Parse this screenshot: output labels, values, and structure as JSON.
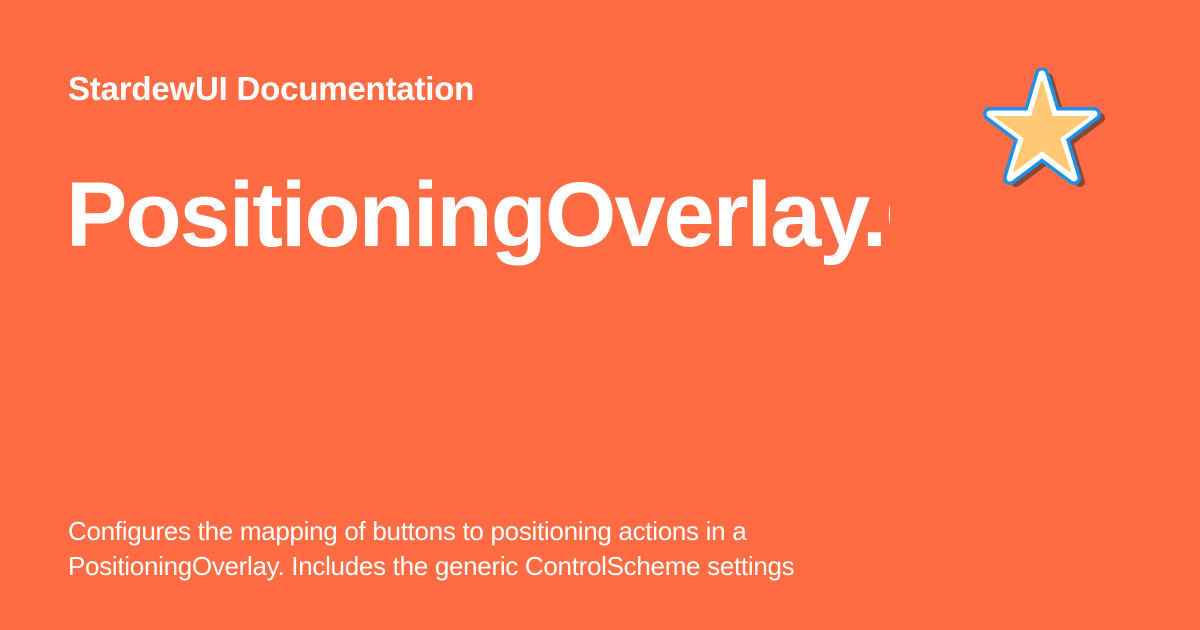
{
  "site": {
    "name": "StardewUI Documentation"
  },
  "page": {
    "title": "PositioningOverlay.ControlScheme",
    "description": "Configures the mapping of buttons to positioning actions in a PositioningOverlay. Includes the generic ControlScheme settings"
  },
  "logo": {
    "icon": "star-icon",
    "fill": "#ffc875",
    "inner_outline": "#ffffff",
    "outer_outline": "#1e90e6",
    "shadow": "#2a2a2a"
  },
  "colors": {
    "background": "#ff6b43",
    "text": "#ffffff"
  }
}
